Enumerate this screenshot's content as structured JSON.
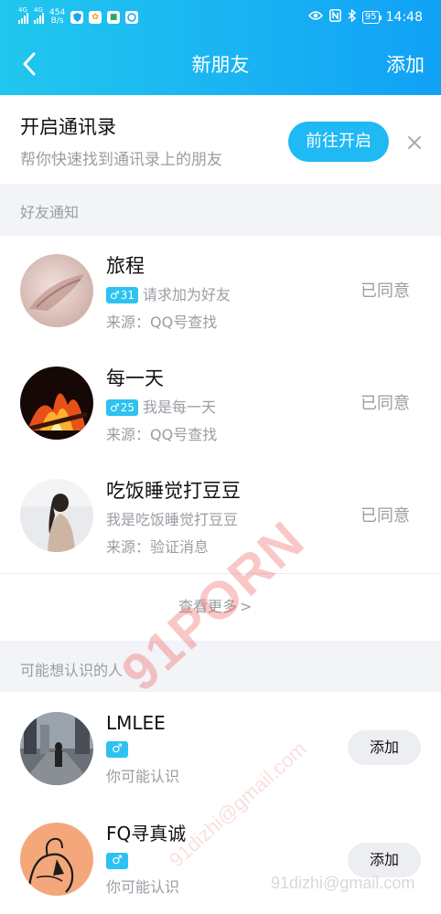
{
  "status_bar": {
    "signal1_label": "4G",
    "signal2_label": "4G",
    "net_speed_value": "454",
    "net_speed_unit": "B/s",
    "battery": "95",
    "time": "14:48"
  },
  "nav": {
    "title": "新朋友",
    "add_label": "添加"
  },
  "contacts_banner": {
    "title": "开启通讯录",
    "subtitle": "帮你快速找到通讯录上的朋友",
    "button_label": "前往开启"
  },
  "friend_notifications": {
    "section_title": "好友通知",
    "items": [
      {
        "name": "旅程",
        "gender_symbol": "♂",
        "age": "31",
        "message": "请求加为好友",
        "source": "来源：QQ号查找",
        "status": "已同意"
      },
      {
        "name": "每一天",
        "gender_symbol": "♂",
        "age": "25",
        "message": "我是每一天",
        "source": "来源：QQ号查找",
        "status": "已同意"
      },
      {
        "name": "吃饭睡觉打豆豆",
        "message": "我是吃饭睡觉打豆豆",
        "source": "来源：验证消息",
        "status": "已同意"
      }
    ],
    "see_more_label": "查看更多",
    "see_more_arrow": ">"
  },
  "people_you_may_know": {
    "section_title": "可能想认识的人",
    "items": [
      {
        "name": "LMLEE",
        "gender_symbol": "♂",
        "subtitle": "你可能认识",
        "add_label": "添加"
      },
      {
        "name": "FQ寻真诚",
        "gender_symbol": "♂",
        "subtitle": "你可能认识",
        "add_label": "添加"
      }
    ]
  },
  "watermark": {
    "main": "91PORN",
    "email": "91dizhi@gmail.com",
    "corner": "91dizhi@gmail.com"
  },
  "colors": {
    "header_start": "#20c7ee",
    "header_end": "#10a1f5",
    "accent_button": "#1fb9f3",
    "gender_badge": "#2cc2f1",
    "section_bg": "#f3f4f8",
    "muted_text": "#9a9da3"
  },
  "icons": {
    "back": "chevron-left-icon",
    "close": "close-icon",
    "gender": "male-icon",
    "see_more": "chevron-right-icon"
  }
}
